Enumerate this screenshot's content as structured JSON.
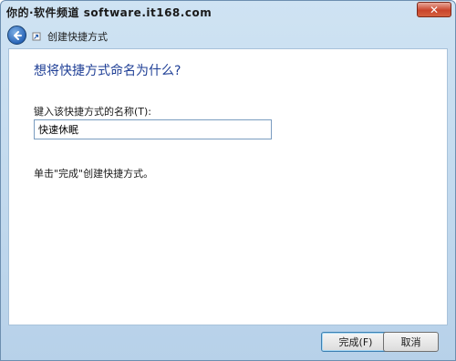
{
  "window": {
    "watermark": "你的·软件频道 software.it168.com",
    "close_label": "✕"
  },
  "nav": {
    "title": "创建快捷方式",
    "back_icon": "back-arrow-icon",
    "wizard_icon": "shortcut-wizard-icon"
  },
  "page": {
    "heading": "想将快捷方式命名为什么?",
    "name_label": "键入该快捷方式的名称(T):",
    "name_value": "快速休眠",
    "instruction": "单击\"完成\"创建快捷方式。"
  },
  "footer": {
    "finish_label": "完成(F)",
    "cancel_label": "取消"
  },
  "colors": {
    "heading": "#1f3f96",
    "chrome": "#b7d1e9"
  }
}
